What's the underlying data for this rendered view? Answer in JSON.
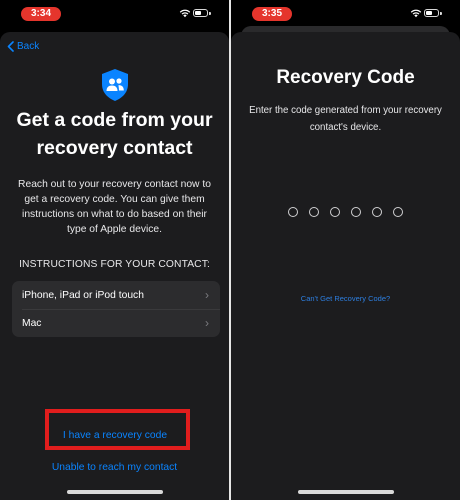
{
  "left_screen": {
    "status": {
      "time": "3:34",
      "icons": [
        "wifi-icon",
        "battery-icon"
      ]
    },
    "nav": {
      "back_label": "Back"
    },
    "icon": "people-shield-icon",
    "title": "Get a code from your recovery contact",
    "description": "Reach out to your recovery contact now to get a recovery code. You can give them instructions on what to do based on their type of Apple device.",
    "instructions_header": "INSTRUCTIONS FOR YOUR CONTACT:",
    "options": [
      {
        "label": "iPhone, iPad or iPod touch"
      },
      {
        "label": "Mac"
      }
    ],
    "primary_link": "I have a recovery code",
    "secondary_link": "Unable to reach my contact"
  },
  "right_screen": {
    "status": {
      "time": "3:35",
      "icons": [
        "wifi-icon",
        "battery-icon"
      ]
    },
    "title": "Recovery Code",
    "description": "Enter the code generated from your recovery contact's device.",
    "code_length": 6,
    "help_link": "Can't Get Recovery Code?"
  },
  "colors": {
    "accent": "#0a84ff",
    "highlight": "#e11d1d",
    "time_pill": "#e5352c",
    "sheet_background": "#1c1c1e",
    "list_background": "#2c2c2e"
  }
}
